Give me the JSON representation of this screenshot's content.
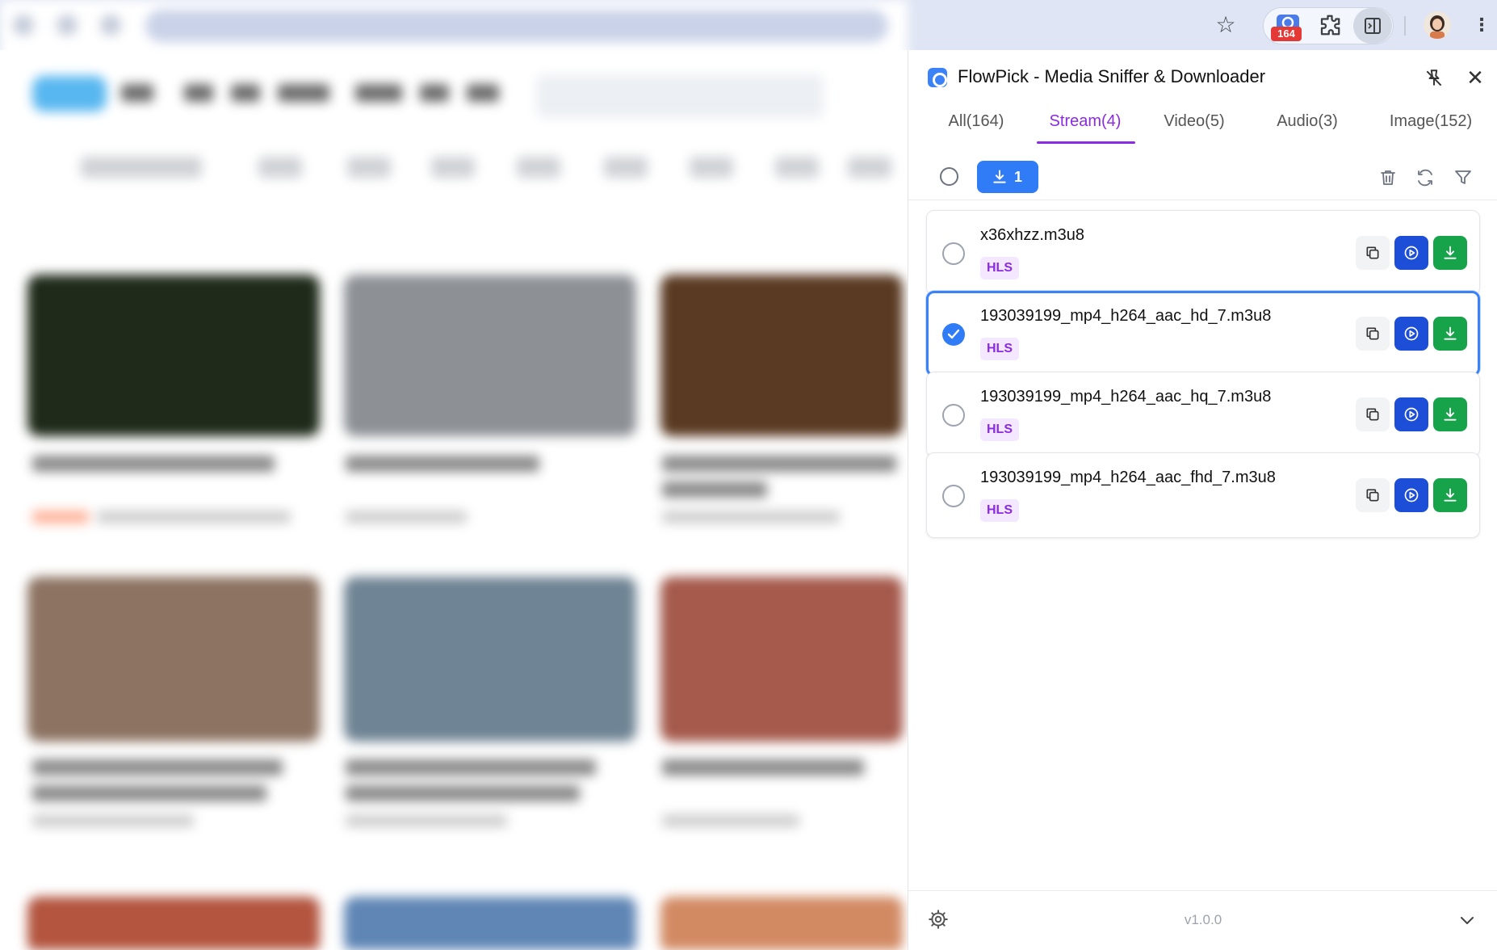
{
  "toolbar": {
    "extension_badge": "164"
  },
  "panel": {
    "title": "FlowPick - Media Sniffer & Downloader",
    "tabs": [
      {
        "label": "All(164)"
      },
      {
        "label": "Stream(4)"
      },
      {
        "label": "Video(5)"
      },
      {
        "label": "Audio(3)"
      },
      {
        "label": "Image(152)"
      }
    ],
    "active_tab": "Stream(4)",
    "download_count": "1",
    "items": [
      {
        "name": "x36xhzz.m3u8",
        "tag": "HLS",
        "selected": false
      },
      {
        "name": "193039199_mp4_h264_aac_hd_7.m3u8",
        "tag": "HLS",
        "selected": true
      },
      {
        "name": "193039199_mp4_h264_aac_hq_7.m3u8",
        "tag": "HLS",
        "selected": false
      },
      {
        "name": "193039199_mp4_h264_aac_fhd_7.m3u8",
        "tag": "HLS",
        "selected": false
      }
    ],
    "version": "v1.0.0"
  },
  "colors": {
    "accent_purple": "#8b2be2",
    "primary_blue": "#2f7cf6",
    "play_blue": "#1d4ed8",
    "download_green": "#16a34a",
    "tag_bg": "#f3e8ff"
  }
}
